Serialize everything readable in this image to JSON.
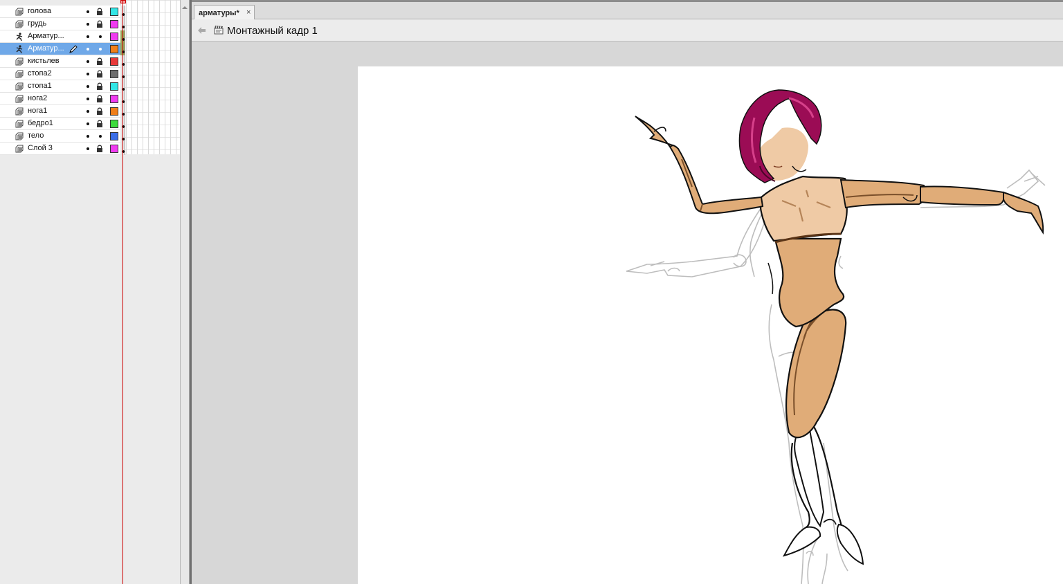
{
  "document": {
    "tab_label": "арматуры*",
    "tab_close": "×",
    "scene_label": "Монтажный кадр 1"
  },
  "layers": [
    {
      "name": "голова",
      "type": "layer",
      "locked": true,
      "color": "#33e6e6",
      "selected": false
    },
    {
      "name": "грудь",
      "type": "layer",
      "locked": true,
      "color": "#f03cf0",
      "selected": false
    },
    {
      "name": "Арматур...",
      "type": "armature",
      "locked": false,
      "color": "#f03cf0",
      "selected": false
    },
    {
      "name": "Арматур...",
      "type": "armature",
      "locked": false,
      "color": "#f07f1a",
      "selected": true
    },
    {
      "name": "кистьлев",
      "type": "layer",
      "locked": true,
      "color": "#e83a3a",
      "selected": false
    },
    {
      "name": "стопа2",
      "type": "layer",
      "locked": true,
      "color": "#6e6e6e",
      "selected": false
    },
    {
      "name": "стопа1",
      "type": "layer",
      "locked": true,
      "color": "#33e6e6",
      "selected": false
    },
    {
      "name": "нога2",
      "type": "layer",
      "locked": true,
      "color": "#f03cf0",
      "selected": false
    },
    {
      "name": "нога1",
      "type": "layer",
      "locked": true,
      "color": "#f07f1a",
      "selected": false
    },
    {
      "name": "бедро1",
      "type": "layer",
      "locked": true,
      "color": "#3ddc3d",
      "selected": false
    },
    {
      "name": "тело",
      "type": "layer",
      "locked": false,
      "color": "#3a6ee8",
      "selected": false
    },
    {
      "name": "Слой 3",
      "type": "layer",
      "locked": true,
      "color": "#f03cf0",
      "selected": false
    }
  ],
  "colors": {
    "skin": "#e0ac78",
    "skin_light": "#efcaa5",
    "hair": "#9b0c55",
    "selection": "#6fa8e8",
    "playhead": "#cc0000"
  }
}
